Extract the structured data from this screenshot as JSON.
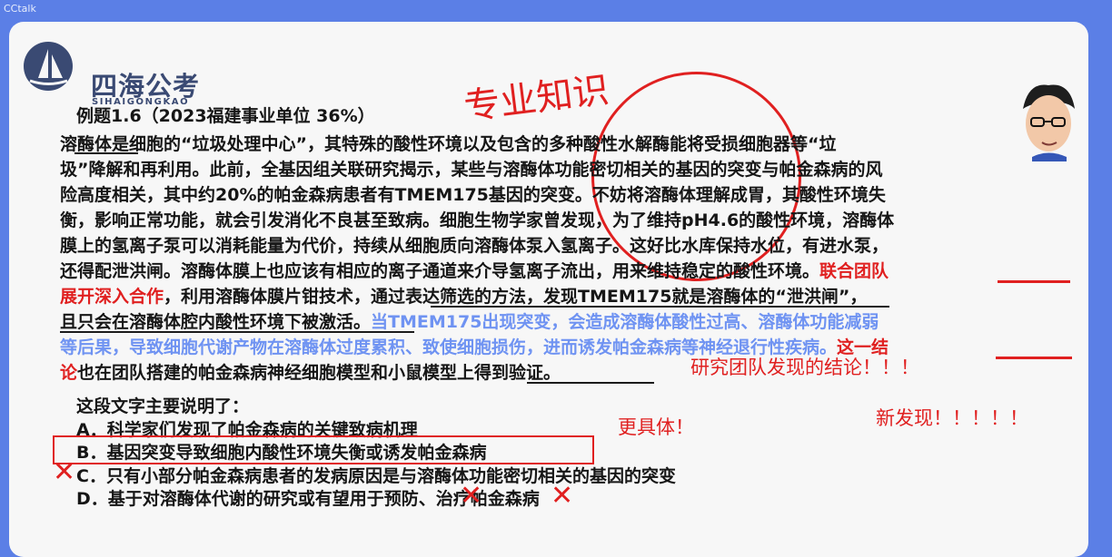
{
  "window": {
    "app_label": "CCtalk"
  },
  "brand": {
    "name": "四海公考",
    "subtitle": "SIHAIGONGKAO"
  },
  "slide": {
    "example_title": "例题1.6（2023福建事业单位 36%）",
    "paragraph_lines": [
      {
        "parts": [
          {
            "text": "溶酶体",
            "style": "normal"
          },
          {
            "text": "是细胞的“垃圾处理中心”，其特殊的酸性环境以及包含的多种酸性水解酶能将受损细胞器等“垃",
            "style": "normal"
          }
        ]
      },
      {
        "parts": [
          {
            "text": "圾”降解和再利用。此前，全基因组关联研究揭示，某些与溶酶体功能密切相关的基因的突变与帕金森病的风",
            "style": "normal"
          }
        ]
      },
      {
        "parts": [
          {
            "text": "险高度相关，其中约20%的帕金森病患者有TMEM175基因的突变。不妨将溶酶体理解成胃，其酸性环境失",
            "style": "normal"
          }
        ]
      },
      {
        "parts": [
          {
            "text": "衡，影响正常功能，就会引发消化不良甚至致病。细胞生物学家曾发现，为了维持pH4.6的酸性环境，溶酶体",
            "style": "normal"
          }
        ]
      },
      {
        "parts": [
          {
            "text": "膜上的氢离子泵可以消耗能量为代价，持续从细胞质向溶酶体泵入氢离子。这好比水库保持水位，有进水泵，",
            "style": "normal"
          }
        ]
      },
      {
        "parts": [
          {
            "text": "还得配泄洪闸。溶酶体膜上也应该有相应的离子通道来介导氢离子流出，用来维持稳定的酸性环境。",
            "style": "normal"
          },
          {
            "text": "联合团队",
            "style": "red"
          }
        ]
      },
      {
        "parts": [
          {
            "text": "展开深入合作",
            "style": "red"
          },
          {
            "text": "，利用溶酶体膜片钳技术，通过表达筛选的方法，发现TMEM175就是溶酶体的“泄洪闸”，",
            "style": "normal"
          }
        ]
      },
      {
        "parts": [
          {
            "text": "且只会在溶酶体腔内酸性环境下被激活。",
            "style": "normal"
          },
          {
            "text": "当TMEM175出现突变，会造成溶酶体酸性过高、溶酶体功能减弱",
            "style": "blue"
          }
        ]
      },
      {
        "parts": [
          {
            "text": "等后果，导致细胞代谢产物在溶酶体过度累积、致使细胞损伤，进而诱发帕金森病等神经退行性疾病。",
            "style": "blue"
          },
          {
            "text": "这一结",
            "style": "red"
          }
        ]
      },
      {
        "parts": [
          {
            "text": "论",
            "style": "red"
          },
          {
            "text": "也在团队搭建的帕金森病神经细胞模型和小鼠模型上得到验证。",
            "style": "normal"
          }
        ]
      }
    ],
    "question": "这段文字主要说明了：",
    "options": [
      "A．科学家们发现了帕金森病的关键致病机理",
      "B．基因突变导致细胞内酸性环境失衡或诱发帕金森病",
      "C．只有小部分帕金森病患者的发病原因是与溶酶体功能密切相关的基因的突变",
      "D．基于对溶酶体代谢的研究或有望用于预防、治疗帕金森病"
    ],
    "annotations": {
      "handwritten_top": "专业知识",
      "research_conclusion": "研究团队发现的结论！！！",
      "more_specific": "更具体！",
      "new_finding": "新发现！！！！！"
    }
  }
}
